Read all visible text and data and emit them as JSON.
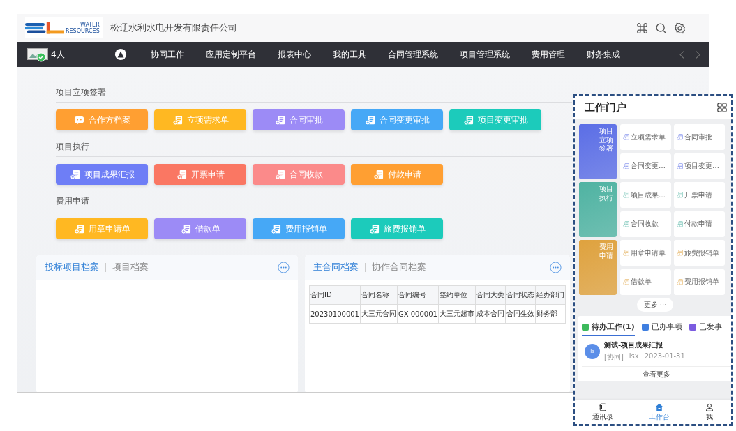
{
  "header": {
    "logo": {
      "line1": "WATER",
      "line2": "RESOURCES"
    },
    "company": "松辽水利水电开发有限责任公司"
  },
  "nav": {
    "online": "4人",
    "items": [
      "协同工作",
      "应用定制平台",
      "报表中心",
      "我的工具",
      "合同管理系统",
      "项目管理系统",
      "费用管理",
      "财务集成"
    ]
  },
  "sections": [
    {
      "title": "项目立项签署",
      "buttons": [
        {
          "label": "合作方档案",
          "color": "#ff9f32",
          "kind": "chat"
        },
        {
          "label": "立项需求单",
          "color": "#ffb822",
          "kind": "form"
        },
        {
          "label": "合同审批",
          "color": "#9c8bf6",
          "kind": "form"
        },
        {
          "label": "合同变更审批",
          "color": "#46a8f6",
          "kind": "form"
        },
        {
          "label": "项目变更审批",
          "color": "#1ccbbb",
          "kind": "form"
        }
      ]
    },
    {
      "title": "项目执行",
      "buttons": [
        {
          "label": "项目成果汇报",
          "color": "#6e7ef6",
          "kind": "form"
        },
        {
          "label": "开票申请",
          "color": "#fa7763",
          "kind": "form"
        },
        {
          "label": "合同收款",
          "color": "#fb8a8a",
          "kind": "form"
        },
        {
          "label": "付款申请",
          "color": "#ff9f32",
          "kind": "form"
        }
      ]
    },
    {
      "title": "费用申请",
      "buttons": [
        {
          "label": "用章申请单",
          "color": "#ffb822",
          "kind": "form"
        },
        {
          "label": "借款单",
          "color": "#9c8bf6",
          "kind": "form"
        },
        {
          "label": "费用报销单",
          "color": "#46a8f6",
          "kind": "form"
        },
        {
          "label": "旅费报销单",
          "color": "#1ccbbb",
          "kind": "form"
        }
      ]
    }
  ],
  "project_card": {
    "tabs": [
      {
        "label": "投标项目档案",
        "selected": true
      },
      {
        "label": "项目档案",
        "selected": false
      }
    ]
  },
  "contract_card": {
    "tabs": [
      {
        "label": "主合同档案",
        "selected": true
      },
      {
        "label": "协作合同档案",
        "selected": false
      }
    ],
    "table": {
      "columns": [
        "合同ID",
        "合同名称",
        "合同编号",
        "签约单位",
        "合同大类",
        "合同状态",
        "经办部门"
      ],
      "rows": [
        [
          "20230100001",
          "大三元合同",
          "GX-000001",
          "大三元超市",
          "成本合同",
          "合同生效",
          "财务部"
        ]
      ]
    }
  },
  "mobile": {
    "title": "工作门户",
    "groups": [
      {
        "label": "项目立项签署",
        "color": "#5b6ee6",
        "items": [
          "立项需求单",
          "合同审批",
          "合同变更…",
          "项目变更…"
        ]
      },
      {
        "label": "项目执行",
        "color": "#4fb3a2",
        "items": [
          "项目成果…",
          "开票申请",
          "合同收款",
          "付款申请"
        ]
      },
      {
        "label": "费用申请",
        "color": "#dfa23e",
        "items": [
          "用章申请单",
          "旅费报销单",
          "借款单",
          "费用报销单"
        ]
      }
    ],
    "more": "更多",
    "more_dots": "···",
    "tabs": [
      {
        "label": "待办工作(1)",
        "selected": true,
        "color": "#3cb95b"
      },
      {
        "label": "已办事项",
        "selected": false,
        "color": "#3f7fe0"
      },
      {
        "label": "已发事",
        "selected": false,
        "color": "#7b5be0"
      }
    ],
    "todo": {
      "avatar": "ls",
      "title": "测试-项目成果汇报",
      "meta": [
        "[协同]",
        "lsx",
        "2023-01-31"
      ]
    },
    "see_more": "查看更多",
    "bottom_nav": [
      {
        "label": "通讯录",
        "kind": "book",
        "selected": false
      },
      {
        "label": "工作台",
        "kind": "home",
        "selected": true
      },
      {
        "label": "我",
        "kind": "person",
        "selected": false
      }
    ]
  }
}
